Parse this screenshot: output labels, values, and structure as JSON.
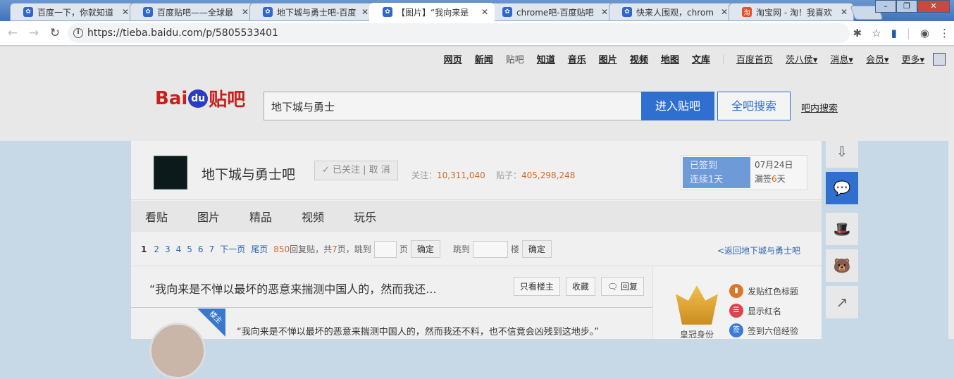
{
  "browser": {
    "tabs": [
      {
        "title": "百度一下，你就知道",
        "icon": "baidu-paw-icon"
      },
      {
        "title": "百度贴吧——全球最",
        "icon": "baidu-paw-icon"
      },
      {
        "title": "地下城与勇士吧-百度",
        "icon": "baidu-paw-icon"
      },
      {
        "title": "【图片】“我向来是",
        "icon": "baidu-paw-icon",
        "active": true
      },
      {
        "title": "chrome吧-百度贴吧",
        "icon": "baidu-paw-icon"
      },
      {
        "title": "快来人围观，chrom",
        "icon": "baidu-paw-icon"
      },
      {
        "title": "淘宝网 - 淘！我喜欢",
        "icon": "taobao-icon"
      }
    ],
    "url": "https://tieba.baidu.com/p/5805533401",
    "close_glyph": "✕"
  },
  "topnav": {
    "links": [
      "网页",
      "新闻",
      "贴吧",
      "知道",
      "音乐",
      "图片",
      "视频",
      "地图",
      "文库"
    ],
    "right": [
      "百度首页",
      "茨八侯▾",
      "消息▾",
      "会员▾",
      "更多▾"
    ]
  },
  "search": {
    "value": "地下城与勇士",
    "enter": "进入贴吧",
    "all": "全吧搜索",
    "inner": "吧内搜索",
    "logo_bai": "Bai",
    "logo_du": "du",
    "logo_tieba": "贴吧"
  },
  "forum": {
    "name": "地下城与勇士吧",
    "follow": "✓ 已关注 | 取 消",
    "follow_label": "关注：",
    "follow_count": "10,311,040",
    "posts_label": "贴子：",
    "posts_count": "405,298,248",
    "signed": "已签到",
    "streak": "连续1天",
    "date": "07月24日",
    "missed_pre": "漏签",
    "missed_n": "6",
    "missed_post": "天"
  },
  "tabs": [
    "看贴",
    "图片",
    "精品",
    "视频",
    "玩乐"
  ],
  "pager": {
    "current": "1",
    "pages": [
      "2",
      "3",
      "4",
      "5",
      "6",
      "7"
    ],
    "next": "下一页",
    "last": "尾页",
    "replies": "850",
    "replies_label": " 回复贴，共",
    "total": "7",
    "total_label": "页，跳到",
    "page_unit": "页",
    "confirm": "确定",
    "jump": "跳到",
    "floor_unit": "楼",
    "back": "<返回地下城与勇士吧"
  },
  "thread": {
    "title": "“我向来是不惮以最坏的恶意来揣测中国人的，然而我还...",
    "buttons": [
      "只看楼主",
      "收藏",
      "回复"
    ],
    "op_badge": "楼主",
    "body": "“我向来是不惮以最坏的恶意来揣测中国人的，然而我还不料，也不信竟会凶残到这地步。”"
  },
  "sidebar": {
    "crown_label": "皇冠身份",
    "perks": [
      "发贴红色标题",
      "显示红名",
      "签到六倍经验"
    ]
  }
}
